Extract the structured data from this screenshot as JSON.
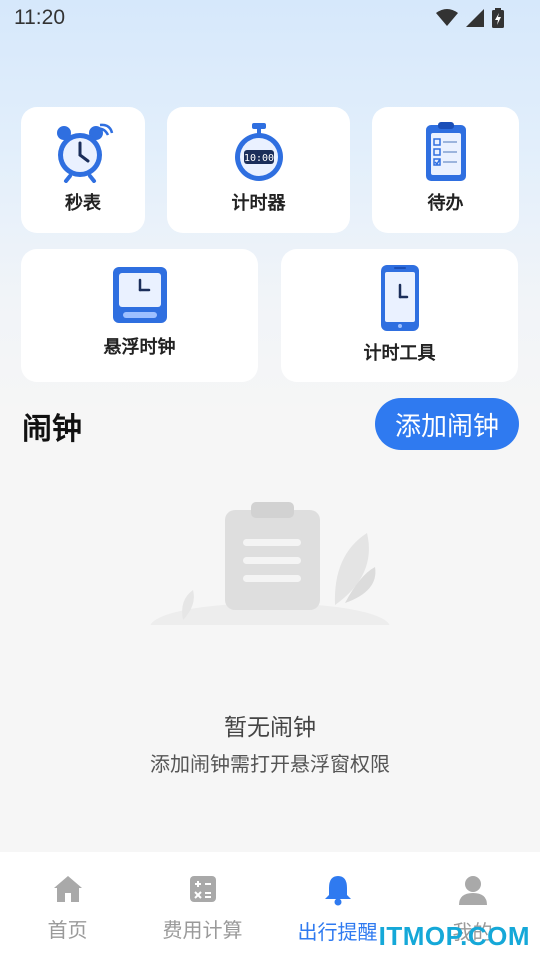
{
  "status_bar": {
    "time": "11:20"
  },
  "tools": [
    {
      "label": "秒表",
      "icon": "alarm-clock-icon"
    },
    {
      "label": "计时器",
      "icon": "timer-icon"
    },
    {
      "label": "待办",
      "icon": "checklist-icon"
    },
    {
      "label": "悬浮时钟",
      "icon": "desk-clock-icon"
    },
    {
      "label": "计时工具",
      "icon": "phone-clock-icon"
    }
  ],
  "alarm_section": {
    "title": "闹钟",
    "add_button": "添加闹钟"
  },
  "empty_state": {
    "title": "暂无闹钟",
    "subtitle": "添加闹钟需打开悬浮窗权限"
  },
  "tabbar": {
    "tabs": [
      {
        "label": "首页",
        "icon": "home-icon",
        "active": false
      },
      {
        "label": "费用计算",
        "icon": "calculator-icon",
        "active": false
      },
      {
        "label": "出行提醒",
        "icon": "bell-icon",
        "active": true
      },
      {
        "label": "我的",
        "icon": "person-icon",
        "active": false
      }
    ]
  },
  "watermark": "ITMOP.COM",
  "colors": {
    "accent": "#2f7af0",
    "card_bg": "#ffffff",
    "page_bg": "#f6f6f6"
  }
}
